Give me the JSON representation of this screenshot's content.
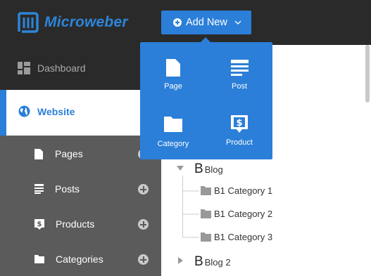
{
  "header": {
    "brand": "Microweber",
    "add_new_label": "Add New",
    "colors": {
      "accent": "#2b7fd8",
      "topbar": "#2a2a2a",
      "sidebar": "#5b5b5b"
    }
  },
  "sidebar": {
    "dashboard": "Dashboard",
    "website": "Website",
    "items": [
      {
        "label": "Pages",
        "icon": "page-icon"
      },
      {
        "label": "Posts",
        "icon": "posts-icon"
      },
      {
        "label": "Products",
        "icon": "product-icon"
      },
      {
        "label": "Categories",
        "icon": "folder-icon"
      }
    ]
  },
  "add_new_menu": {
    "items": [
      {
        "label": "Page",
        "icon": "page-icon"
      },
      {
        "label": "Post",
        "icon": "post-icon"
      },
      {
        "label": "Category",
        "icon": "folder-icon"
      },
      {
        "label": "Product",
        "icon": "product-icon"
      }
    ]
  },
  "tree": {
    "blog": {
      "letter": "B",
      "label": "Blog",
      "expanded": true,
      "children": [
        "B1 Category 1",
        "B1 Category 2",
        "B1 Category 3"
      ]
    },
    "blog2": {
      "letter": "B",
      "label": "Blog 2",
      "expanded": false
    }
  }
}
